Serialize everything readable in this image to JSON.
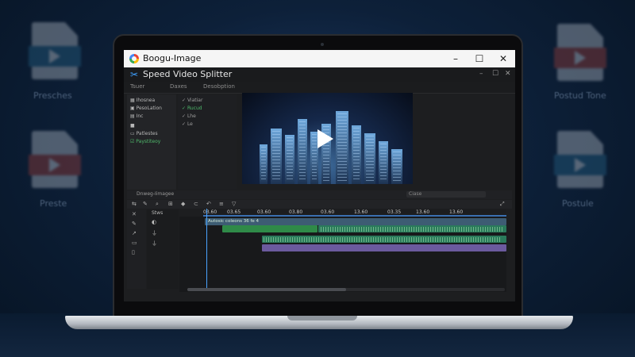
{
  "background_labels": [
    "Presches",
    "Preste",
    "Postud Tone",
    "Postule"
  ],
  "window": {
    "title": "Boogu-Image",
    "controls": [
      "–",
      "☐",
      "✕"
    ]
  },
  "app": {
    "name": "Speed Video Splitter",
    "controls": [
      "–",
      "☐",
      "✕"
    ]
  },
  "menu": [
    "Tsuer",
    "Daxes",
    "Desobption"
  ],
  "left_panel": {
    "items": [
      {
        "label": "Ihosnea",
        "icon": "grid-icon"
      },
      {
        "label": "PesoLation",
        "icon": "image-icon"
      },
      {
        "label": "Inc",
        "icon": "film-icon"
      },
      {
        "label": "",
        "icon": "folder-icon"
      },
      {
        "label": "Patlestes",
        "icon": "folder-icon"
      },
      {
        "label": "Paystiteoy",
        "icon": "check-icon"
      }
    ]
  },
  "mid_panel": {
    "items": [
      {
        "label": "Viatiar",
        "icon": "check-icon"
      },
      {
        "label": "Rucud",
        "icon": "check-icon"
      },
      {
        "label": "Lhe",
        "icon": "check-icon"
      },
      {
        "label": "Le",
        "icon": "check-icon"
      }
    ]
  },
  "timeline": {
    "label": "Dnweg-Iimagee",
    "search_label": "Ciase",
    "ruler_ticks": [
      "03.60",
      "03.65",
      "03.60",
      "03.80",
      "03.60",
      "13.60",
      "03.35",
      "13.60",
      "13.60"
    ],
    "track_label": "Stws",
    "clip_title": "Autosic coleons 36 fe 4"
  },
  "colors": {
    "accent": "#3fa1ff",
    "green_clip": "#2f8a48",
    "teal_clip": "#2a7a5b",
    "purple_clip": "#6b5a9e"
  }
}
